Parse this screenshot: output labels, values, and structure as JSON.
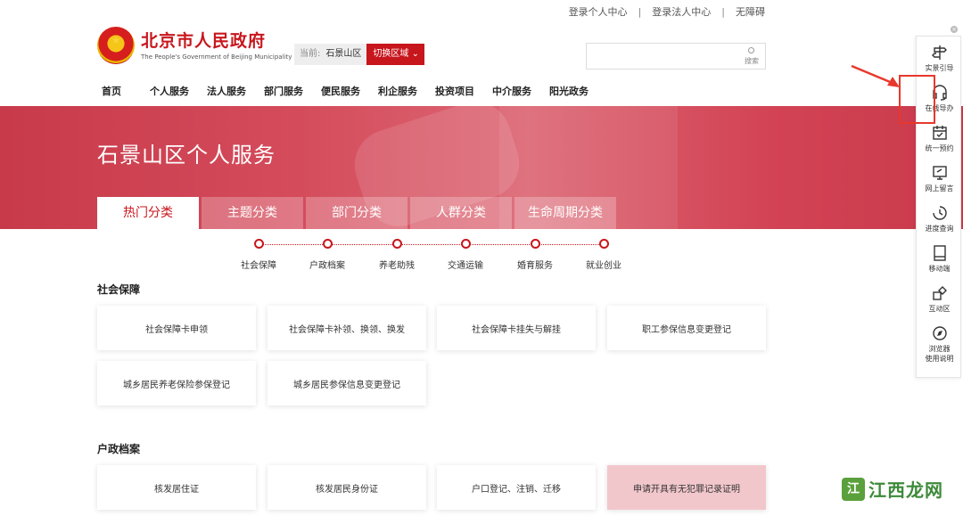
{
  "top_links": [
    "登录个人中心",
    "登录法人中心",
    "无障碍"
  ],
  "logo": {
    "cn": "北京市人民政府",
    "en": "The People's Government of Beijing Municipality"
  },
  "region": {
    "prefix": "当前:",
    "name": "石景山区",
    "switch_label": "切换区域"
  },
  "search": {
    "label": "搜索",
    "placeholder": ""
  },
  "nav": [
    "首页",
    "个人服务",
    "法人服务",
    "部门服务",
    "便民服务",
    "利企服务",
    "投资项目",
    "中介服务",
    "阳光政务"
  ],
  "banner": {
    "title": "石景山区个人服务"
  },
  "tabs": [
    {
      "label": "热门分类",
      "active": true
    },
    {
      "label": "主题分类",
      "active": false
    },
    {
      "label": "部门分类",
      "active": false
    },
    {
      "label": "人群分类",
      "active": false
    },
    {
      "label": "生命周期分类",
      "active": false
    }
  ],
  "timeline": [
    "社会保障",
    "户政档案",
    "养老助残",
    "交通运输",
    "婚育服务",
    "就业创业"
  ],
  "sections": [
    {
      "title": "社会保障",
      "cards": [
        "社会保障卡申领",
        "社会保障卡补领、换领、换发",
        "社会保障卡挂失与解挂",
        "职工参保信息变更登记",
        "城乡居民养老保险参保登记",
        "城乡居民参保信息变更登记"
      ]
    },
    {
      "title": "户政档案",
      "cards": [
        "核发居住证",
        "核发居民身份证",
        "户口登记、注销、迁移",
        "申请开具有无犯罪记录证明"
      ]
    }
  ],
  "sidebar": [
    {
      "icon": "signpost-icon",
      "label": "实景引导"
    },
    {
      "icon": "headset-icon",
      "label": "在线导办"
    },
    {
      "icon": "calendar-icon",
      "label": "统一预约"
    },
    {
      "icon": "message-icon",
      "label": "网上留言"
    },
    {
      "icon": "clock-icon",
      "label": "进度查询"
    },
    {
      "icon": "tablet-icon",
      "label": "移动端"
    },
    {
      "icon": "interact-icon",
      "label": "互动区"
    },
    {
      "icon": "compass-icon",
      "label": "浏览器",
      "label2": "使用说明"
    }
  ],
  "watermark": {
    "text": "江西龙网",
    "logo": "江"
  },
  "colors": {
    "brand_red": "#c8161d",
    "highlight_red": "#e8382c"
  }
}
